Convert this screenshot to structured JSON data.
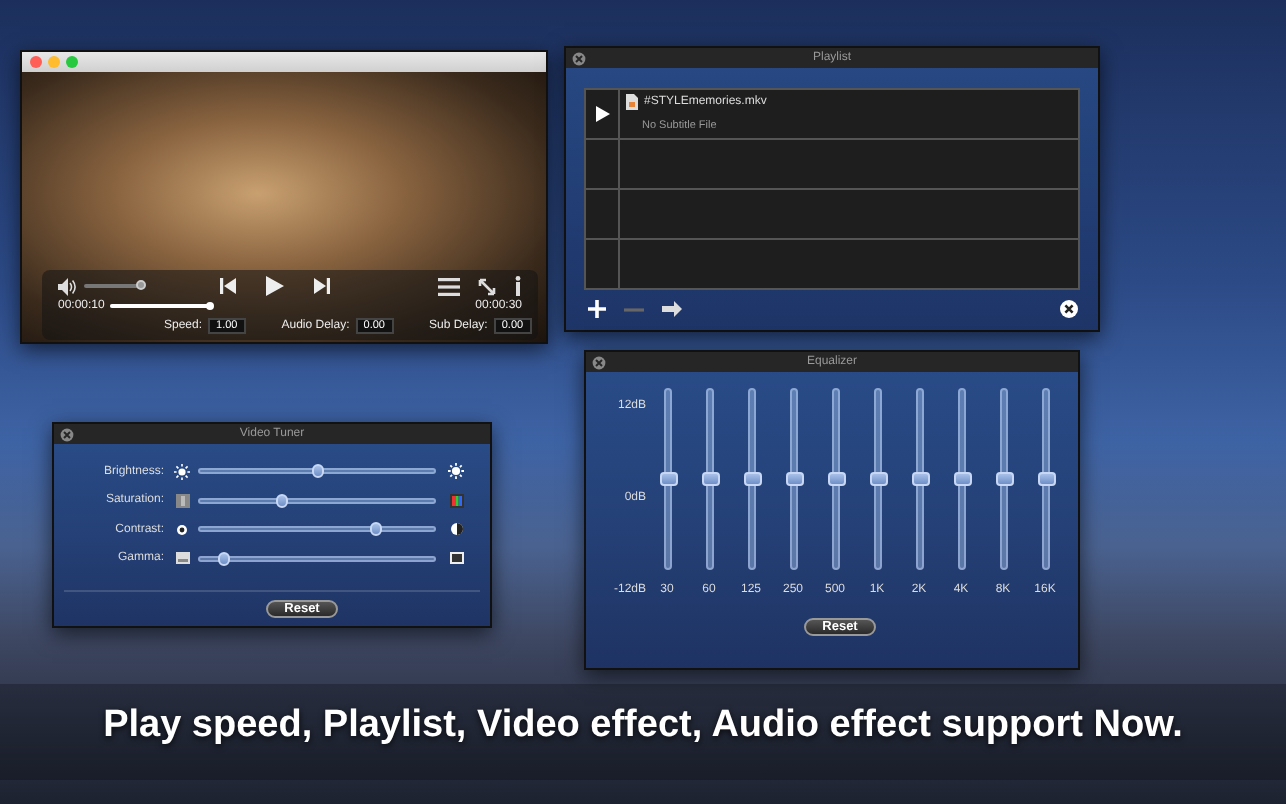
{
  "player": {
    "volume": {
      "level": 0.95
    },
    "elapsed": "00:00:10",
    "progress": {
      "level": 1
    },
    "remaining": "00:00:30",
    "readouts": [
      {
        "label": "Speed:",
        "value": "1.00"
      },
      {
        "label": "Audio Delay:",
        "value": "0.00"
      },
      {
        "label": "Sub Delay:",
        "value": "0.00"
      }
    ]
  },
  "playlist": {
    "title": "Playlist",
    "items": [
      {
        "name": "#STYLEmemories.mkv",
        "subtitle": "No Subtitle File",
        "playing": true
      }
    ]
  },
  "video_tuner": {
    "title": "Video Tuner",
    "sliders": [
      {
        "kind": "brightness",
        "label": "Brightness:",
        "level": 0.5
      },
      {
        "kind": "saturation",
        "label": "Saturation:",
        "level": 0.35
      },
      {
        "kind": "contrast",
        "label": "Contrast:",
        "level": 0.75
      },
      {
        "kind": "gamma",
        "label": "Gamma:",
        "level": 0.1
      }
    ],
    "reset": "Reset"
  },
  "equalizer": {
    "title": "Equalizer",
    "scale": [
      "12dB",
      "0dB",
      "-12dB"
    ],
    "bands": [
      {
        "label": "30",
        "level": 0.5
      },
      {
        "label": "60",
        "level": 0.5
      },
      {
        "label": "125",
        "level": 0.5
      },
      {
        "label": "250",
        "level": 0.5
      },
      {
        "label": "500",
        "level": 0.5
      },
      {
        "label": "1K",
        "level": 0.5
      },
      {
        "label": "2K",
        "level": 0.5
      },
      {
        "label": "4K",
        "level": 0.5
      },
      {
        "label": "8K",
        "level": 0.5
      },
      {
        "label": "16K",
        "level": 0.5
      }
    ],
    "reset": "Reset"
  },
  "caption": "Play speed, Playlist, Video effect, Audio effect support Now."
}
